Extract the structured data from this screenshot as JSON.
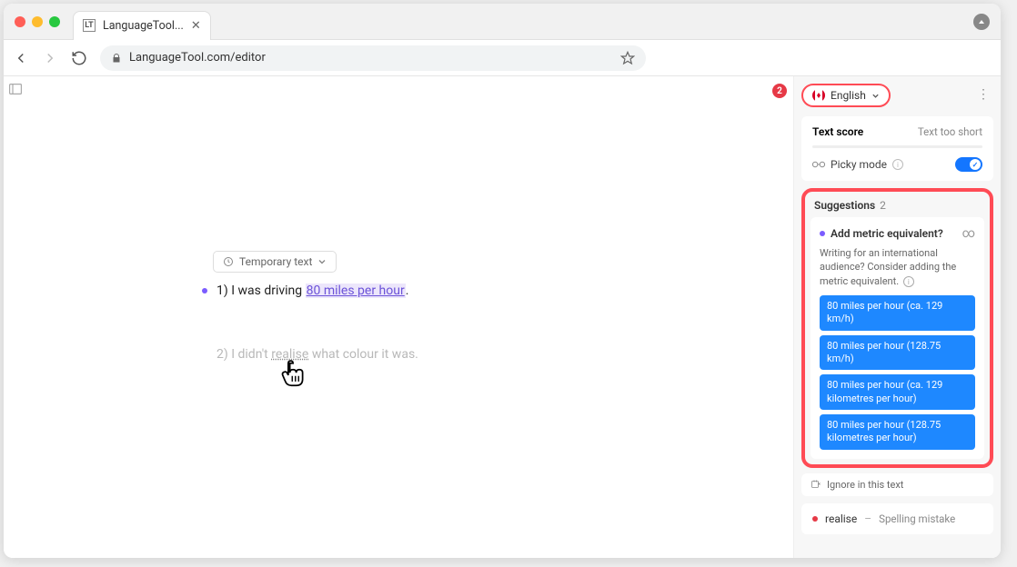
{
  "browser": {
    "tab_title": "LanguageTool...",
    "url_display": "LanguageTool.com/editor"
  },
  "editor": {
    "temp_text_label": "Temporary text",
    "line1_prefix": "1) I was driving ",
    "line1_highlight": "80 miles per hour",
    "line1_suffix": ".",
    "line2_prefix": "2) I didn't ",
    "line2_spell": "realise",
    "line2_suffix": " what colour it was."
  },
  "sidebar": {
    "error_count": "2",
    "language": "English",
    "more_glyph": "⋮",
    "text_score_label": "Text score",
    "text_score_status": "Text too short",
    "picky_label": "Picky mode",
    "suggestions_label": "Suggestions",
    "suggestions_count": "2",
    "metric": {
      "title": "Add metric equivalent?",
      "desc": "Writing for an international audience? Consider adding the metric equivalent.",
      "link_glyph": "∞",
      "chips": [
        "80 miles per hour (ca. 129 km/h)",
        "80 miles per hour (128.75 km/h)",
        "80 miles per hour (ca. 129 kilometres per hour)",
        "80 miles per hour (128.75 kilometres per hour)"
      ]
    },
    "ignore_label": "Ignore in this text",
    "spell": {
      "word": "realise",
      "dash": "–",
      "label": "Spelling mistake"
    }
  }
}
